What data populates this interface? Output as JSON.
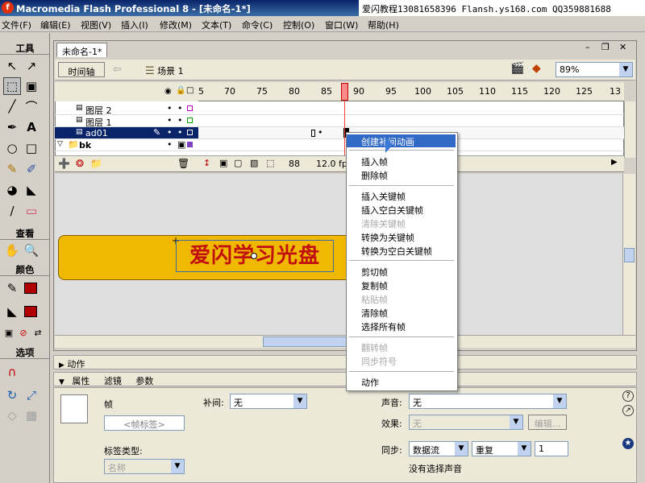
{
  "app": {
    "title": "Macromedia Flash Professional 8 - [未命名-1*]",
    "icon": "flash-app-icon",
    "watermark": "爱闪教程13081658396 Flansh.ys168.com QQ359881688"
  },
  "menu": [
    "文件(F)",
    "编辑(E)",
    "视图(V)",
    "插入(I)",
    "修改(M)",
    "文本(T)",
    "命令(C)",
    "控制(O)",
    "窗口(W)",
    "帮助(H)"
  ],
  "tools": {
    "header": "工具",
    "view_header": "查看",
    "color_header": "颜色",
    "options_header": "选项",
    "stroke_color": "#b00000",
    "fill_color": "#b00000"
  },
  "document": {
    "tab": "未命名-1*",
    "timeline_button": "时间轴",
    "scene": "场景 1",
    "zoom": "89%"
  },
  "timeline": {
    "ruler": [
      "5",
      "70",
      "75",
      "80",
      "85",
      "90",
      "95",
      "100",
      "105",
      "110",
      "115",
      "120",
      "125",
      "13"
    ],
    "layers": [
      {
        "name": "图层 2",
        "selected": false
      },
      {
        "name": "图层 1",
        "selected": false
      },
      {
        "name": "ad01",
        "selected": true
      },
      {
        "name": "bk",
        "selected": false
      }
    ],
    "current_frame": "88",
    "fps": "12.0 fps"
  },
  "stage": {
    "banner_text": "爱闪学习光盘",
    "banner_color": "#f0b800",
    "text_color": "#c01010"
  },
  "context_menu": [
    {
      "label": "创建补间动画",
      "state": "highlight"
    },
    {
      "sep": true
    },
    {
      "label": "插入帧",
      "state": "normal"
    },
    {
      "label": "删除帧",
      "state": "normal"
    },
    {
      "sep": true
    },
    {
      "label": "插入关键帧",
      "state": "normal"
    },
    {
      "label": "插入空白关键帧",
      "state": "normal"
    },
    {
      "label": "清除关键帧",
      "state": "disabled"
    },
    {
      "label": "转换为关键帧",
      "state": "normal"
    },
    {
      "label": "转换为空白关键帧",
      "state": "normal"
    },
    {
      "sep": true
    },
    {
      "label": "剪切帧",
      "state": "normal"
    },
    {
      "label": "复制帧",
      "state": "normal"
    },
    {
      "label": "粘贴帧",
      "state": "disabled"
    },
    {
      "label": "清除帧",
      "state": "normal"
    },
    {
      "label": "选择所有帧",
      "state": "normal"
    },
    {
      "sep": true
    },
    {
      "label": "翻转帧",
      "state": "disabled"
    },
    {
      "label": "同步符号",
      "state": "disabled"
    },
    {
      "sep": true
    },
    {
      "label": "动作",
      "state": "normal"
    }
  ],
  "panels": {
    "actions": "动作",
    "tabs": [
      "属性",
      "滤镜",
      "参数"
    ],
    "frame_label": "帧",
    "frame_label_input": "<帧标签>",
    "label_type_label": "标签类型:",
    "label_type_value": "名称",
    "tween_label": "补间:",
    "tween_value": "无",
    "sound_label": "声音:",
    "sound_value": "无",
    "effect_label": "效果:",
    "effect_value": "无",
    "edit_button": "编辑...",
    "sync_label": "同步:",
    "sync_value": "数据流",
    "repeat_value": "重复",
    "repeat_count": "1",
    "no_sound": "没有选择声音"
  }
}
